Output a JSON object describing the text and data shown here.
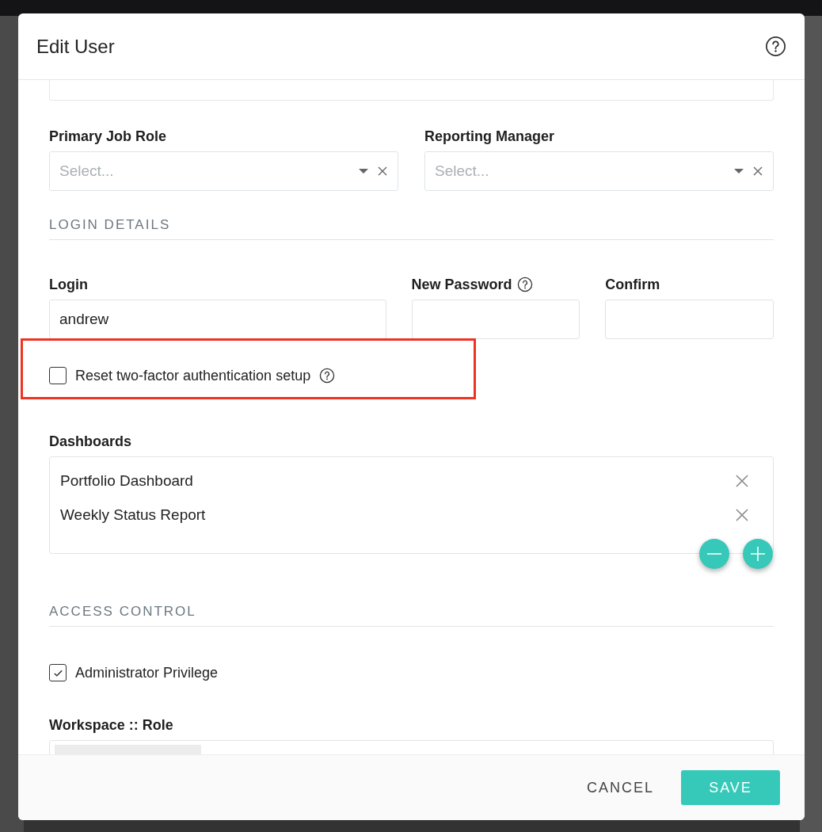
{
  "dialog": {
    "title": "Edit User",
    "help_icon": true
  },
  "select_fields": [
    {
      "label": "Primary Job Role",
      "placeholder": "Select..."
    },
    {
      "label": "Reporting Manager",
      "placeholder": "Select..."
    }
  ],
  "login_section": {
    "heading": "LOGIN DETAILS",
    "fields": [
      {
        "label": "Login",
        "value": "andrew",
        "help_icon": false
      },
      {
        "label": "New Password",
        "help_icon": true
      },
      {
        "label": "Confirm",
        "help_icon": false
      }
    ],
    "reset_2fa": {
      "label": "Reset two-factor authentication setup",
      "checked": false,
      "help_icon": true,
      "highlighted": true
    }
  },
  "dashboards": {
    "label": "Dashboards",
    "items": [
      {
        "name": "Portfolio Dashboard"
      },
      {
        "name": "Weekly Status Report"
      }
    ]
  },
  "access_section": {
    "heading": "ACCESS CONTROL",
    "admin": {
      "label": "Administrator Privilege",
      "checked": true
    },
    "workspace_label": "Workspace :: Role"
  },
  "footer": {
    "buttons": [
      {
        "label": "CANCEL",
        "kind": "text"
      },
      {
        "label": "SAVE",
        "kind": "primary"
      }
    ]
  }
}
